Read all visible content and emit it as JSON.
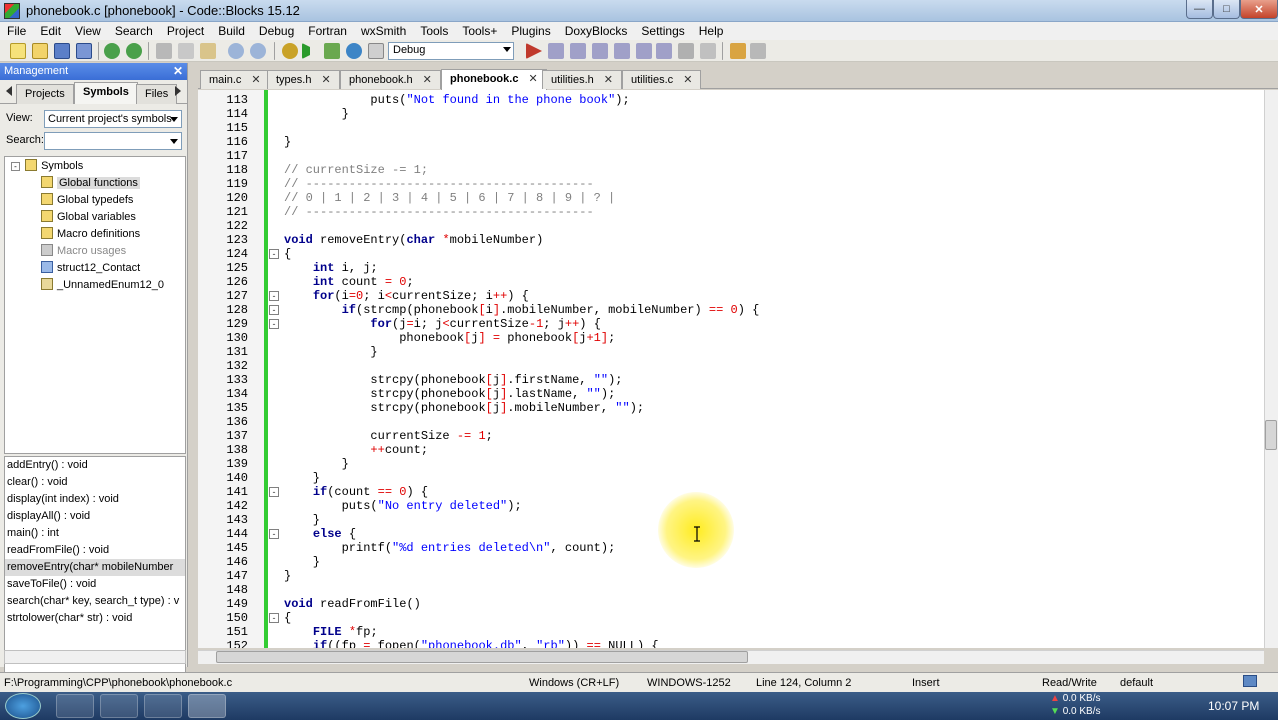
{
  "window": {
    "title": "phonebook.c [phonebook] - Code::Blocks 15.12"
  },
  "menu": [
    "File",
    "Edit",
    "View",
    "Search",
    "Project",
    "Build",
    "Debug",
    "Fortran",
    "wxSmith",
    "Tools",
    "Tools+",
    "Plugins",
    "DoxyBlocks",
    "Settings",
    "Help"
  ],
  "toolbar": {
    "build_target": "Debug"
  },
  "management": {
    "title": "Management",
    "tabs": [
      "Projects",
      "Symbols",
      "Files"
    ],
    "view_label": "View:",
    "view_value": "Current project's symbols",
    "search_label": "Search:",
    "search_value": "",
    "tree": [
      "Symbols",
      "Global functions",
      "Global typedefs",
      "Global variables",
      "Macro definitions",
      "Macro usages",
      "struct12_Contact",
      "_UnnamedEnum12_0"
    ],
    "members": [
      "addEntry() : void",
      "clear() : void",
      "display(int index) : void",
      "displayAll() : void",
      "main() : int",
      "readFromFile() : void",
      "removeEntry(char* mobileNumber",
      "saveToFile() : void",
      "search(char* key, search_t type) : v",
      "strtolower(char* str) : void"
    ]
  },
  "editor_tabs": [
    "main.c",
    "types.h",
    "phonebook.h",
    "phonebook.c",
    "utilities.h",
    "utilities.c"
  ],
  "code": [
    {
      "n": "113",
      "t": "            puts(\"Not found in the phone book\");"
    },
    {
      "n": "114",
      "t": "        }"
    },
    {
      "n": "115",
      "t": ""
    },
    {
      "n": "116",
      "t": "}"
    },
    {
      "n": "117",
      "t": ""
    },
    {
      "n": "118",
      "t": "// currentSize -= 1;"
    },
    {
      "n": "119",
      "t": "// ----------------------------------------"
    },
    {
      "n": "120",
      "t": "// 0 | 1 | 2 | 3 | 4 | 5 | 6 | 7 | 8 | 9 | ? |"
    },
    {
      "n": "121",
      "t": "// ----------------------------------------"
    },
    {
      "n": "122",
      "t": ""
    },
    {
      "n": "123",
      "t": "void removeEntry(char *mobileNumber)"
    },
    {
      "n": "124",
      "t": "{"
    },
    {
      "n": "125",
      "t": "    int i, j;"
    },
    {
      "n": "126",
      "t": "    int count = 0;"
    },
    {
      "n": "127",
      "t": "    for(i=0; i<currentSize; i++) {"
    },
    {
      "n": "128",
      "t": "        if(strcmp(phonebook[i].mobileNumber, mobileNumber) == 0) {"
    },
    {
      "n": "129",
      "t": "            for(j=i; j<currentSize-1; j++) {"
    },
    {
      "n": "130",
      "t": "                phonebook[j] = phonebook[j+1];"
    },
    {
      "n": "131",
      "t": "            }"
    },
    {
      "n": "132",
      "t": ""
    },
    {
      "n": "133",
      "t": "            strcpy(phonebook[j].firstName, \"\");"
    },
    {
      "n": "134",
      "t": "            strcpy(phonebook[j].lastName, \"\");"
    },
    {
      "n": "135",
      "t": "            strcpy(phonebook[j].mobileNumber, \"\");"
    },
    {
      "n": "136",
      "t": ""
    },
    {
      "n": "137",
      "t": "            currentSize -= 1;"
    },
    {
      "n": "138",
      "t": "            ++count;"
    },
    {
      "n": "139",
      "t": "        }"
    },
    {
      "n": "140",
      "t": "    }"
    },
    {
      "n": "141",
      "t": "    if(count == 0) {"
    },
    {
      "n": "142",
      "t": "        puts(\"No entry deleted\");"
    },
    {
      "n": "143",
      "t": "    }"
    },
    {
      "n": "144",
      "t": "    else {"
    },
    {
      "n": "145",
      "t": "        printf(\"%d entries deleted\\n\", count);"
    },
    {
      "n": "146",
      "t": "    }"
    },
    {
      "n": "147",
      "t": "}"
    },
    {
      "n": "148",
      "t": ""
    },
    {
      "n": "149",
      "t": "void readFromFile()"
    },
    {
      "n": "150",
      "t": "{"
    },
    {
      "n": "151",
      "t": "    FILE *fp;"
    },
    {
      "n": "152",
      "t": "    if((fp = fopen(\"phonebook.db\", \"rb\")) == NULL) {"
    }
  ],
  "status": {
    "path": "F:\\Programming\\CPP\\phonebook\\phonebook.c",
    "eol": "Windows (CR+LF)",
    "encoding": "WINDOWS-1252",
    "position": "Line 124, Column 2",
    "mode": "Insert",
    "access": "Read/Write",
    "lang": "default"
  },
  "taskbar": {
    "net_up": "0.0 KB/s",
    "net_down": "0.0 KB/s",
    "clock": "10:07 PM"
  }
}
